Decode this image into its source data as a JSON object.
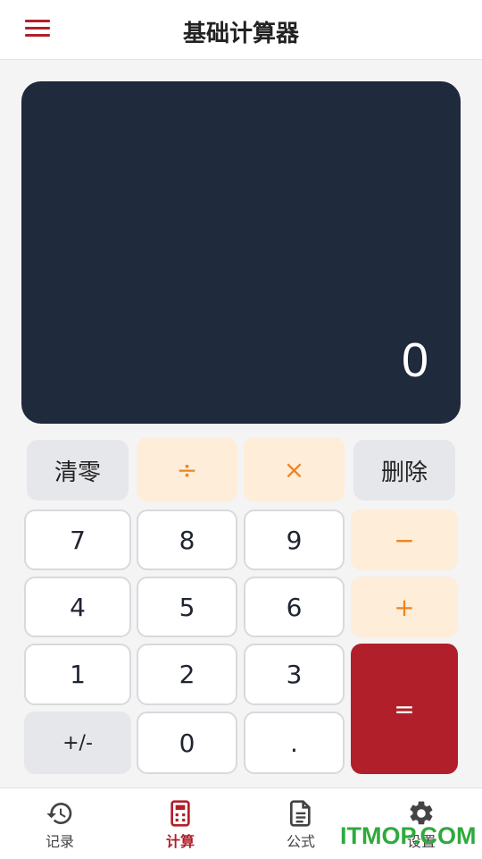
{
  "header": {
    "title": "基础计算器",
    "menu_icon": "hamburger-icon"
  },
  "display": {
    "value": "0"
  },
  "keys": {
    "clear": "清零",
    "divide": "÷",
    "multiply": "×",
    "delete": "删除",
    "seven": "7",
    "eight": "8",
    "nine": "9",
    "minus": "−",
    "four": "4",
    "five": "5",
    "six": "6",
    "plus": "+",
    "one": "1",
    "two": "2",
    "three": "3",
    "equals": "=",
    "negate": "+/-",
    "zero": "0",
    "dot": "."
  },
  "tabs": [
    {
      "label": "记录",
      "icon": "history-icon",
      "active": false
    },
    {
      "label": "计算",
      "icon": "calculator-icon",
      "active": true
    },
    {
      "label": "公式",
      "icon": "document-icon",
      "active": false
    },
    {
      "label": "设置",
      "icon": "gear-icon",
      "active": false
    }
  ],
  "watermark": "ITMOP.COM",
  "colors": {
    "accent": "#b1202a",
    "operator_bg": "#feedd8",
    "operator_text": "#f08322",
    "display_bg": "#1f2a3c"
  }
}
